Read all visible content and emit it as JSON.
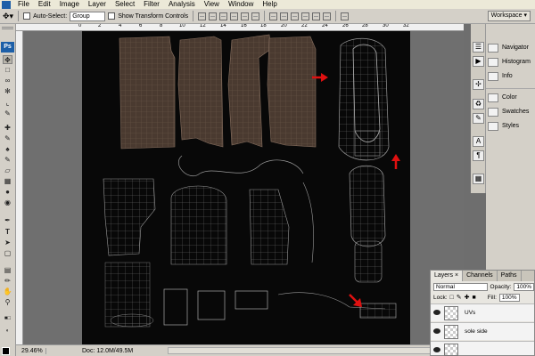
{
  "menu": [
    "File",
    "Edit",
    "Image",
    "Layer",
    "Select",
    "Filter",
    "Analysis",
    "View",
    "Window",
    "Help"
  ],
  "options": {
    "auto_select_label": "Auto-Select:",
    "auto_select_value": "Group",
    "show_transform_label": "Show Transform Controls",
    "workspace_label": "Workspace ▾"
  },
  "tools": {
    "badge": "Ps",
    "icons": [
      "move",
      "marquee",
      "lasso",
      "quick-select",
      "crop",
      "slice",
      "healing-brush",
      "brush",
      "stamp",
      "history-brush",
      "eraser",
      "gradient",
      "blur",
      "dodge",
      "pen",
      "type",
      "path-select",
      "shape",
      "notes",
      "eyedropper",
      "hand",
      "zoom"
    ]
  },
  "ruler": {
    "top_ticks": [
      "0",
      "2",
      "4",
      "6",
      "8",
      "10",
      "12",
      "14",
      "16",
      "18",
      "20",
      "22",
      "24",
      "26",
      "28",
      "30",
      "32"
    ]
  },
  "status": {
    "zoom": "29.46%",
    "doc": "Doc: 12.0M/49.5M"
  },
  "panels": {
    "group1": [
      "Navigator",
      "Histogram",
      "Info"
    ],
    "group2": [
      "Color",
      "Swatches",
      "Styles"
    ]
  },
  "layers_panel": {
    "tabs": [
      "Layers",
      "Channels",
      "Paths"
    ],
    "tab_close": "×",
    "blend_mode": "Normal",
    "opacity_label": "Opacity:",
    "opacity_value": "100%",
    "lock_label": "Lock:",
    "fill_label": "Fill:",
    "fill_value": "100%",
    "layers": [
      {
        "name": "UVs"
      },
      {
        "name": "sole side"
      },
      {
        "name": ""
      }
    ]
  },
  "colors": {
    "canvas_bg": "#080808",
    "uv_wire": "#8c8c8c",
    "leather": "#4a3a30",
    "annotation_arrow": "#e01010",
    "ps_blue": "#1d5fa8"
  }
}
